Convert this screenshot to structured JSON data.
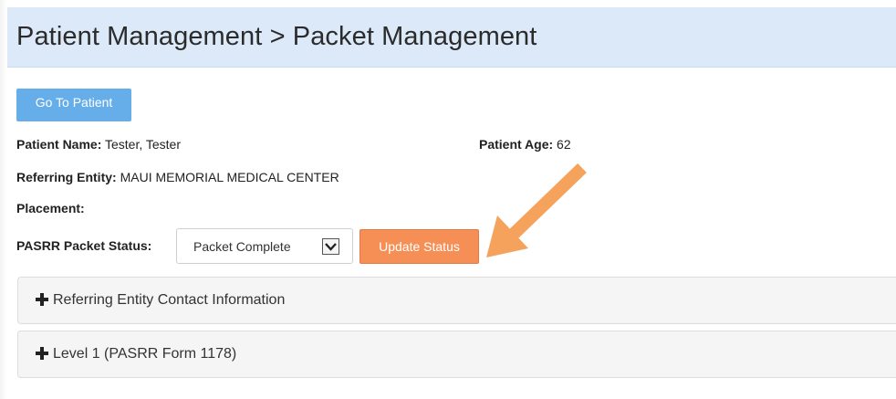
{
  "header": {
    "title": "Patient Management > Packet Management"
  },
  "actions": {
    "go_to_patient": "Go To Patient",
    "update_status": "Update Status"
  },
  "patient": {
    "name_label": "Patient Name:",
    "name_value": "Tester, Tester",
    "age_label": "Patient Age:",
    "age_value": "62",
    "referring_entity_label": "Referring Entity:",
    "referring_entity_value": "MAUI MEMORIAL MEDICAL CENTER",
    "placement_label": "Placement:",
    "placement_value": ""
  },
  "packet_status": {
    "label": "PASRR Packet Status:",
    "selected": "Packet Complete"
  },
  "panels": [
    {
      "title": "Referring Entity Contact Information"
    },
    {
      "title": "Level 1 (PASRR Form 1178)"
    }
  ],
  "colors": {
    "header_bg": "#dce9f8",
    "primary_button": "#66aeea",
    "update_button": "#f68f55",
    "annotation_arrow": "#f5a25d"
  },
  "icons": {
    "expand": "plus-icon",
    "dropdown": "chevron-down-icon",
    "annotation": "arrow-icon"
  }
}
